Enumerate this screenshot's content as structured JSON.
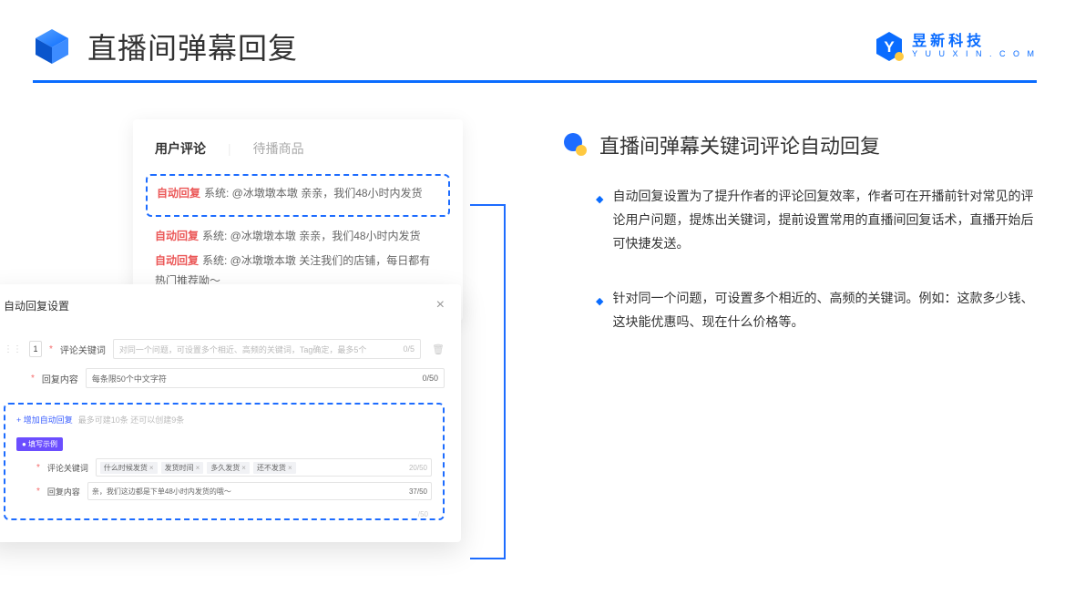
{
  "header": {
    "title": "直播间弹幕回复",
    "brand_cn": "昱新科技",
    "brand_en": "Y U U X I N . C O M"
  },
  "comments": {
    "tab_active": "用户评论",
    "tab_inactive": "待播商品",
    "badge": "自动回复",
    "r1": "系统: @冰墩墩本墩 亲亲，我们48小时内发货",
    "r2": "系统: @冰墩墩本墩 亲亲，我们48小时内发货",
    "r3": "系统: @冰墩墩本墩 关注我们的店铺，每日都有热门推荐呦～"
  },
  "settings": {
    "title": "自动回复设置",
    "close": "×",
    "idx": "1",
    "l_keyword": "评论关键词",
    "p_keyword": "对同一个问题，可设置多个相近、高频的关键词，Tag确定，最多5个",
    "c_keyword": "0/5",
    "l_content": "回复内容",
    "p_content": "每条限50个中文字符",
    "c_content": "0/50",
    "add": "+ 增加自动回复",
    "add_muted": "最多可建10条 还可以创建9条",
    "ex_badge": "● 填写示例",
    "ex_l_keyword": "评论关键词",
    "t1": "什么时候发货",
    "t2": "发货时间",
    "t3": "多久发货",
    "t4": "还不发货",
    "ex_c_keyword": "20/50",
    "ex_l_content": "回复内容",
    "ex_content": "亲，我们这边都是下单48小时内发货的哦～",
    "ex_c_content": "37/50",
    "stray": "/50"
  },
  "right": {
    "title": "直播间弹幕关键词评论自动回复",
    "b1": "自动回复设置为了提升作者的评论回复效率，作者可在开播前针对常见的评论用户问题，提炼出关键词，提前设置常用的直播间回复话术，直播开始后可快捷发送。",
    "b2": "针对同一个问题，可设置多个相近的、高频的关键词。例如：这款多少钱、这块能优惠吗、现在什么价格等。"
  }
}
